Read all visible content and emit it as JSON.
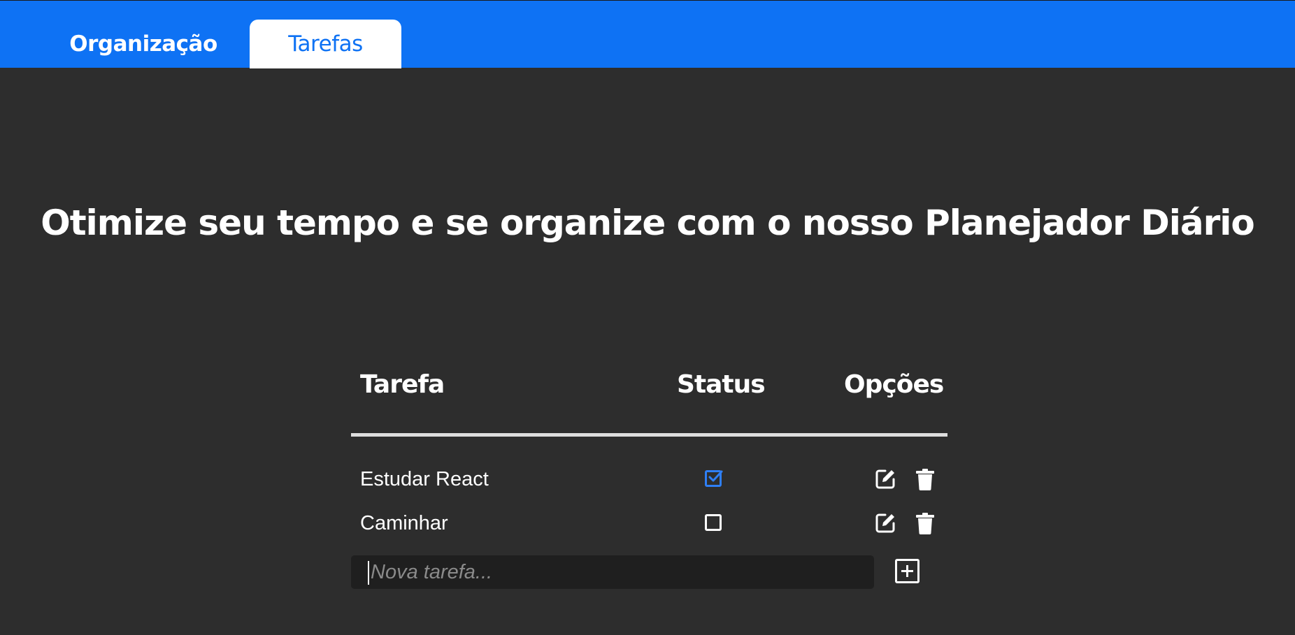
{
  "nav": {
    "tabs": [
      {
        "label": "Organização",
        "active": false
      },
      {
        "label": "Tarefas",
        "active": true
      }
    ],
    "accent": "#0e72f4"
  },
  "hero": {
    "title": "Otimize seu tempo e se organize com o nosso Planejador Diário"
  },
  "table": {
    "headers": {
      "task": "Tarefa",
      "status": "Status",
      "options": "Opções"
    },
    "rows": [
      {
        "task": "Estudar React",
        "done": true,
        "status_icon": "checked-square-icon",
        "actions": [
          "edit-icon",
          "trash-icon"
        ]
      },
      {
        "task": "Caminhar",
        "done": false,
        "status_icon": "empty-square-icon",
        "actions": [
          "edit-icon",
          "trash-icon"
        ]
      }
    ]
  },
  "new_task": {
    "placeholder": "Nova tarefa...",
    "value": "",
    "add_icon": "plus-square-icon"
  },
  "colors": {
    "background": "#2d2d2d",
    "input_background": "#1f1f1f",
    "checked": "#2f7ff5",
    "text": "#ffffff"
  }
}
